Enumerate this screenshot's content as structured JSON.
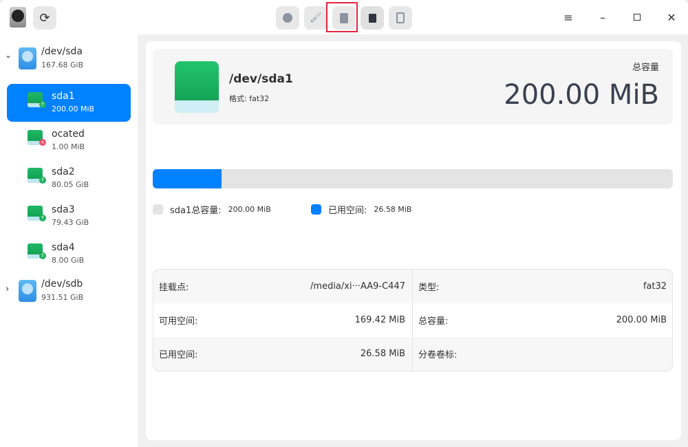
{
  "toolbar": {
    "refresh": "refresh",
    "partition": "partition",
    "wipe": "wipe",
    "format": "format",
    "unmount": "unmount",
    "resize": "resize"
  },
  "sidebar": {
    "disks": [
      {
        "name": "/dev/sda",
        "size": "167.68 GiB",
        "expanded": true,
        "partitions": [
          {
            "name": "sda1",
            "size": "200.00 MiB",
            "status": "mounted",
            "selected": true
          },
          {
            "name": "ocated",
            "size": "1.00 MiB",
            "status": "error"
          },
          {
            "name": "sda2",
            "size": "80.05 GiB",
            "status": "mounted"
          },
          {
            "name": "sda3",
            "size": "79.43 GiB",
            "status": "mounted"
          },
          {
            "name": "sda4",
            "size": "8.00 GiB",
            "status": "mounted"
          }
        ]
      },
      {
        "name": "/dev/sdb",
        "size": "931.51 GiB",
        "expanded": false
      }
    ]
  },
  "header": {
    "name": "/dev/sda1",
    "format": "格式: fat32",
    "total_label": "总容量",
    "total": "200.00 MiB"
  },
  "usage": {
    "used_fraction": 0.1329,
    "legend_total_label": "sda1总容量:",
    "legend_total": "200.00 MiB",
    "legend_used_label": "已用空间:",
    "legend_used": "26.58 MiB",
    "used_color": "#0081ff",
    "free_color": "#e4e4e4"
  },
  "info": {
    "rows": [
      {
        "l1": "挂载点:",
        "v1": "/media/xi···AA9-C447",
        "l2": "类型:",
        "v2": "fat32"
      },
      {
        "l1": "可用空间:",
        "v1": "169.42 MiB",
        "l2": "总容量:",
        "v2": "200.00 MiB"
      },
      {
        "l1": "已用空间:",
        "v1": "26.58 MiB",
        "l2": "分卷卷标:",
        "v2": ""
      }
    ]
  }
}
